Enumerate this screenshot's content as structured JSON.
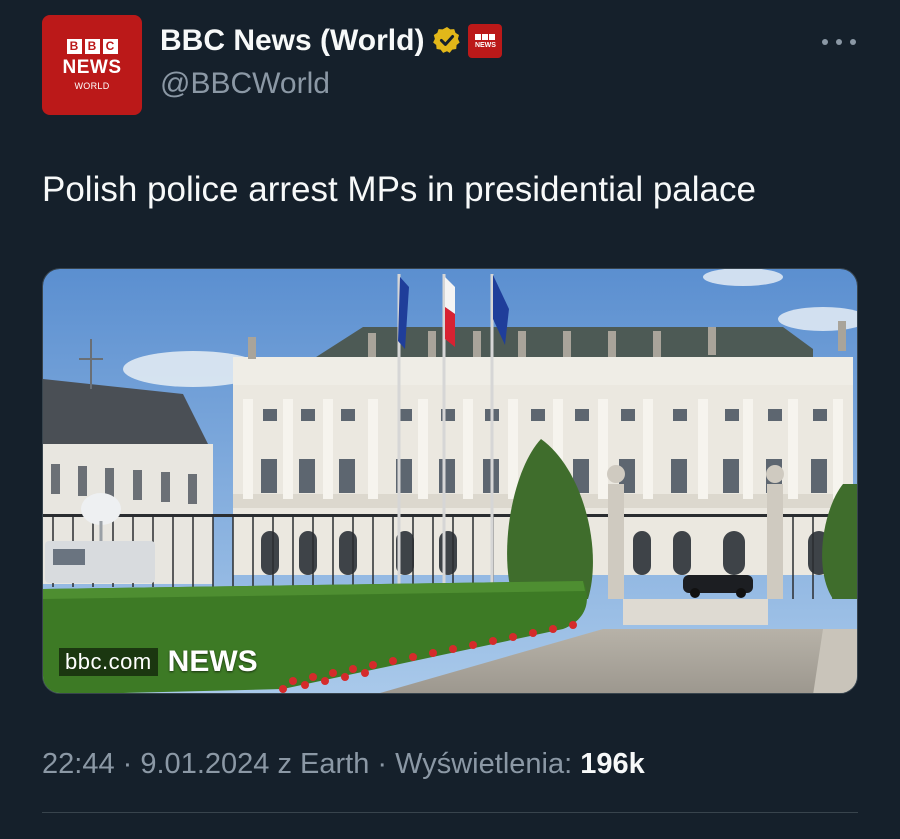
{
  "colors": {
    "background": "#15202b",
    "text_primary": "#f7f9f9",
    "text_secondary": "#8b98a5",
    "bbc_red": "#bb1919",
    "verified_gold": "#e2b719"
  },
  "author": {
    "avatar_letters": [
      "B",
      "B",
      "C"
    ],
    "avatar_news": "NEWS",
    "avatar_sub": "WORLD",
    "display_name": "BBC News (World)",
    "handle": "@BBCWorld",
    "verified_icon": "gold-verified-badge-icon",
    "affiliate_icon": "bbc-news-affiliate-icon"
  },
  "more_icon": "more-options-icon",
  "tweet": {
    "text": "Polish police arrest MPs in presidential palace"
  },
  "media": {
    "description_icon": "presidential-palace-photo",
    "watermark_site": "bbc.com",
    "watermark_brand": "NEWS"
  },
  "meta": {
    "time": "22:44",
    "date": "9.01.2024",
    "source": "z Earth",
    "views_label": "Wyświetlenia:",
    "views_count": "196k",
    "separator": "·"
  }
}
